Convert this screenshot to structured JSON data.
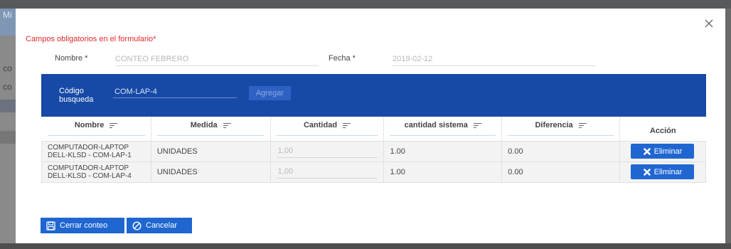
{
  "background": {
    "left_fragments": [
      "Mi",
      "co",
      "co"
    ]
  },
  "form": {
    "required_note": "Campos obligatorios en el formulario*",
    "name_label": "Nombre *",
    "name_value": "CONTEO FEBRERO",
    "date_label": "Fecha *",
    "date_value": "2019-02-12"
  },
  "search": {
    "label_line1": "Código",
    "label_line2": "busqueda",
    "value": "COM-LAP-4",
    "add_label": "Agregar"
  },
  "table": {
    "columns": [
      "Nombre",
      "Medida",
      "Cantidad",
      "cantidad sistema",
      "Diferencia",
      "Acción"
    ],
    "rows": [
      {
        "name_line1": "COMPUTADOR-LAPTOP",
        "name_line2": "DELL-KLSD - COM-LAP-1",
        "measure": "UNIDADES",
        "quantity": "1,00",
        "system_quantity": "1.00",
        "difference": "0.00",
        "action": "Eliminar"
      },
      {
        "name_line1": "COMPUTADOR-LAPTOP",
        "name_line2": "DELL-KLSD - COM-LAP-4",
        "measure": "UNIDADES",
        "quantity": "1,00",
        "system_quantity": "1.00",
        "difference": "0.00",
        "action": "Eliminar"
      }
    ]
  },
  "footer": {
    "close_count_label": "Cerrar conteo",
    "cancel_label": "Cancelar"
  },
  "icons": {
    "close": "close-icon",
    "sort": "sort-icon",
    "delete": "x-icon",
    "save": "save-icon",
    "cancel": "cancel-icon"
  },
  "colors": {
    "primary": "#1f66d1",
    "band": "#1749a6",
    "required": "#e02828"
  }
}
